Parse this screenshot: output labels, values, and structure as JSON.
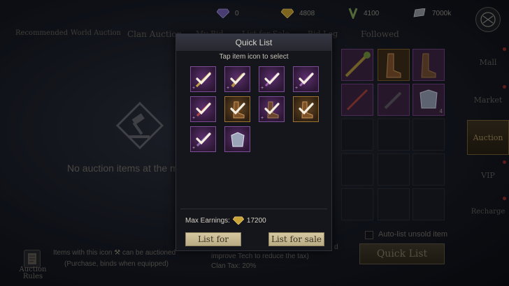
{
  "currencies": [
    {
      "icon": "purple-gem-icon",
      "value": "0"
    },
    {
      "icon": "gold-gem-icon",
      "value": "4808"
    },
    {
      "icon": "green-laurel-icon",
      "value": "4100"
    },
    {
      "icon": "silver-ingot-icon",
      "value": "7000k"
    }
  ],
  "tabs": [
    "Recommended",
    "World Auction",
    "Clan Auction",
    "My Bid",
    "List for Sale",
    "Bid Log",
    "Followed"
  ],
  "empty_text": "No auction items at the m",
  "rules_label": "Auction Rules",
  "info": {
    "line1_a": "Items with this icon",
    "line1_b": "can be auctioned",
    "line2": "(Purchase, binds when equipped)",
    "line3": "improve Tech to reduce the tax)",
    "line4": "Clan Tax: 20%",
    "fragment": "d"
  },
  "auto_list_label": "Auto-list unsold item",
  "bg_quick_list": "Quick List",
  "bg_stack_count": "4",
  "side_nav": [
    {
      "label": "Mall",
      "badge": true,
      "active": false
    },
    {
      "label": "Market",
      "badge": true,
      "active": false
    },
    {
      "label": "Auction",
      "badge": false,
      "active": true
    },
    {
      "label": "VIP",
      "badge": true,
      "active": false
    },
    {
      "label": "Recharge",
      "badge": true,
      "active": false
    }
  ],
  "modal": {
    "title": "Quick List",
    "subtitle": "Tap item icon to select",
    "items": [
      {
        "rarity": "purple",
        "kind": "weapon",
        "selected": true
      },
      {
        "rarity": "purple",
        "kind": "weapon",
        "selected": true
      },
      {
        "rarity": "purple",
        "kind": "weapon",
        "selected": true
      },
      {
        "rarity": "purple",
        "kind": "weapon",
        "selected": true
      },
      {
        "rarity": "purple",
        "kind": "weapon",
        "selected": true
      },
      {
        "rarity": "gold",
        "kind": "boots",
        "selected": true
      },
      {
        "rarity": "purple",
        "kind": "boots",
        "selected": true
      },
      {
        "rarity": "gold",
        "kind": "boots",
        "selected": true
      },
      {
        "rarity": "purple",
        "kind": "weapon",
        "selected": true
      },
      {
        "rarity": "purple",
        "kind": "armor",
        "selected": false
      }
    ],
    "earnings_label": "Max Earnings:",
    "earnings_value": "17200",
    "earnings_icon": "gold-gem-icon",
    "btn_left": "List for",
    "btn_right": "List for sale"
  },
  "colors": {
    "accent_gold": "#d6c9a2",
    "rarity_purple": "#7a4d96",
    "rarity_gold": "#9d7233",
    "badge_red": "#8a2a25"
  }
}
